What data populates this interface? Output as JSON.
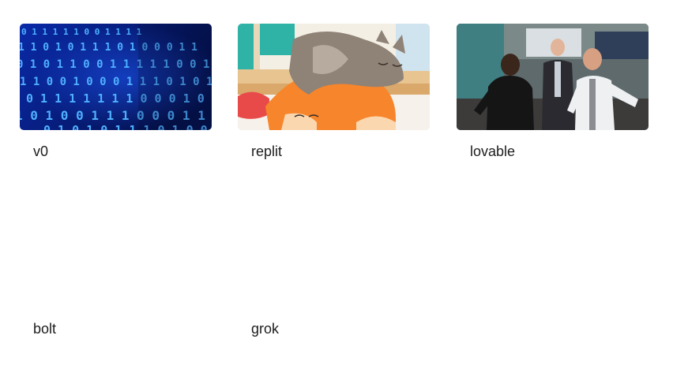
{
  "cards": [
    {
      "label": "v0",
      "thumbnail": "binary-code-image",
      "binary_text": [
        "0 1 1 1 1 1 0 0 1 1 1 1",
        "1 1 0 1 0 1 1 1 0 1 0 0 0 1 1",
        "0 1 0 1 1 0 0 1 1 1 1 1 0 0 1",
        "1 1 0 0 1 0 0 0 1 1 1 0 1 0 1",
        "0 1 1 1 1 1 1 1 0 0 0 1 0",
        "1 0 1 0 0 1 1 1 0 0 0 1 1 1",
        "0 1 0 1 0 1 1 1 0 1 0 0"
      ]
    },
    {
      "label": "replit",
      "thumbnail": "cats-cartoon-image"
    },
    {
      "label": "lovable",
      "thumbnail": "office-celebration-image"
    },
    {
      "label": "bolt",
      "thumbnail": ""
    },
    {
      "label": "grok",
      "thumbnail": ""
    }
  ],
  "colors": {
    "text": "#1d1d1f",
    "binary_bg": "#061a6b",
    "binary_glyph": "#3fa6ff",
    "orange_cat": "#f7852b",
    "grey_cat": "#8f8277"
  }
}
